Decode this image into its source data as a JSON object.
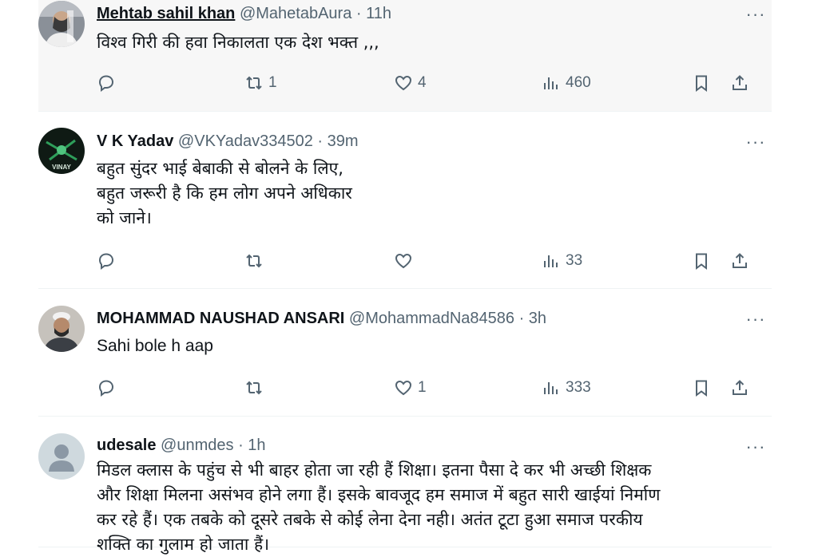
{
  "tweets": [
    {
      "name": "Mehtab sahil khan",
      "handle": "@MahetabAura",
      "time": "11h",
      "text": "विश्व गिरी की हवा निकालता एक देश भक्त ,,,",
      "replies": "",
      "retweets": "1",
      "likes": "4",
      "views": "460",
      "avatar_icon": "user-photo-avatar"
    },
    {
      "name": "V K Yadav",
      "handle": "@VKYadav334502",
      "time": "39m",
      "text": "बहुत सुंदर भाई बेबाकी से बोलने के लिए,\nबहुत जरूरी है कि हम लोग अपने अधिकार\nको जाने।",
      "replies": "",
      "retweets": "",
      "likes": "",
      "views": "33",
      "avatar_text": "VINAY"
    },
    {
      "name": "MOHAMMAD NAUSHAD ANSARI",
      "handle": "@MohammadNa84586",
      "time": "3h",
      "text": "Sahi bole h aap",
      "replies": "",
      "retweets": "",
      "likes": "1",
      "views": "333",
      "avatar_icon": "user-photo-avatar"
    },
    {
      "name": "udesale",
      "handle": "@unmdes",
      "time": "1h",
      "text": "मिडल क्लास के पहुंच से भी बाहर होता जा रही हैं शिक्षा। इतना पैसा दे कर भी अच्छी शिक्षक\nऔर शिक्षा मिलना असंभव होने लगा हैं। इसके बावजूद हम समाज में बहुत सारी खाईयां निर्माण\nकर रहे हैं। एक तबके को दूसरे तबके से कोई लेना देना नही। अतंत टूटा हुआ समाज परकीय\nशक्ति का गुलाम हो जाता हैं।",
      "avatar_icon": "default-profile-avatar"
    }
  ],
  "separator": " · ",
  "more_label": "···"
}
